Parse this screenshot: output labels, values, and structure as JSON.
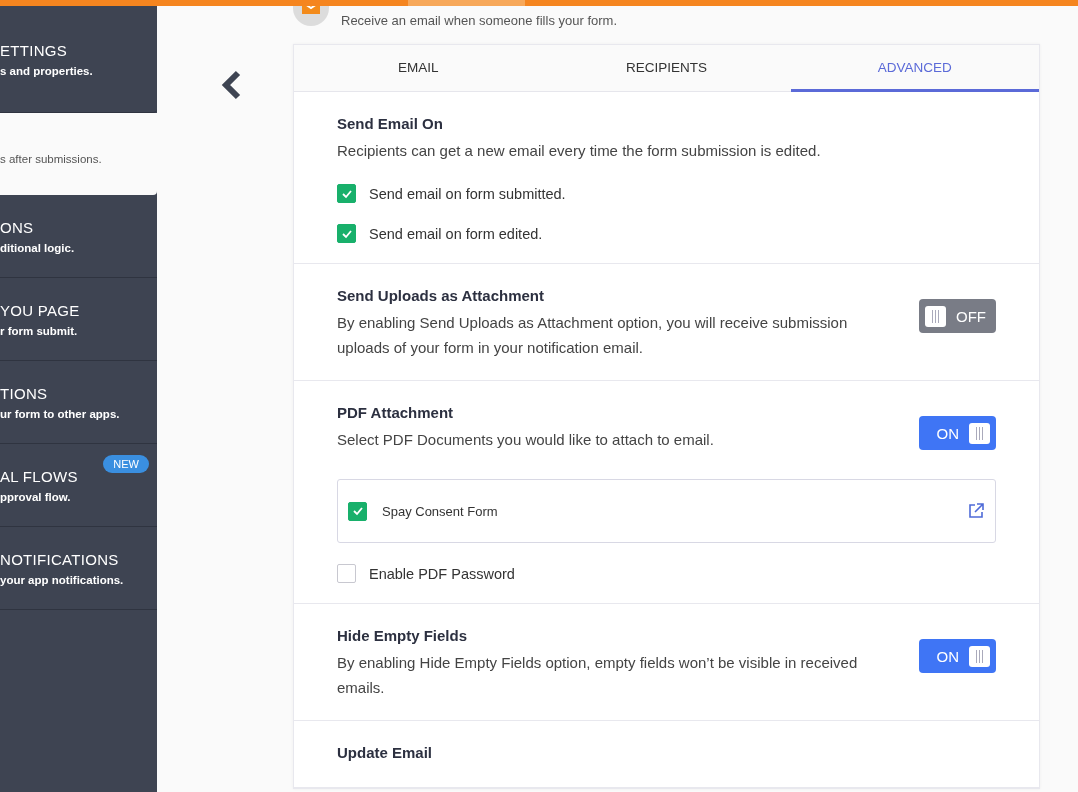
{
  "sidebar": {
    "items": [
      {
        "title": "ETTINGS",
        "subtitle": "s and properties.",
        "selected": false
      },
      {
        "subtitle": "s after submissions.",
        "selected": true
      },
      {
        "title": "ONS",
        "subtitle": "ditional logic.",
        "selected": false
      },
      {
        "title": "YOU PAGE",
        "subtitle": "r form submit.",
        "selected": false
      },
      {
        "title": "TIONS",
        "subtitle": "ur form to other apps.",
        "selected": false
      },
      {
        "title": "AL FLOWS",
        "subtitle": "pproval flow.",
        "selected": false,
        "badge": "NEW"
      },
      {
        "title": "NOTIFICATIONS",
        "subtitle": "your app notifications.",
        "selected": false
      }
    ]
  },
  "header": {
    "description": "Receive an email when someone fills your form."
  },
  "tabs": [
    {
      "label": "EMAIL",
      "selected": false
    },
    {
      "label": "RECIPIENTS",
      "selected": false
    },
    {
      "label": "ADVANCED",
      "selected": true
    }
  ],
  "sections": [
    {
      "title": "Send Email On",
      "description": "Recipients can get a new email every time the form submission is edited.",
      "checks": [
        {
          "label": "Send email on form submitted.",
          "checked": true
        },
        {
          "label": "Send email on form edited.",
          "checked": true
        }
      ]
    },
    {
      "title": "Send Uploads as Attachment",
      "description": "By enabling Send Uploads as Attachment option, you will receive submission uploads of your form in your notification email.",
      "toggle": {
        "on": false,
        "label": "OFF"
      }
    },
    {
      "title": "PDF Attachment",
      "description": "Select PDF Documents you would like to attach to email.",
      "toggle": {
        "on": true,
        "label": "ON"
      },
      "documents": [
        {
          "label": "Spay Consent Form",
          "checked": true
        }
      ],
      "checks": [
        {
          "label": "Enable PDF Password",
          "checked": false
        }
      ]
    },
    {
      "title": "Hide Empty Fields",
      "description": "By enabling Hide Empty Fields option, empty fields won’t be visible in received emails.",
      "toggle": {
        "on": true,
        "label": "ON"
      }
    },
    {
      "title": "Update Email"
    }
  ]
}
